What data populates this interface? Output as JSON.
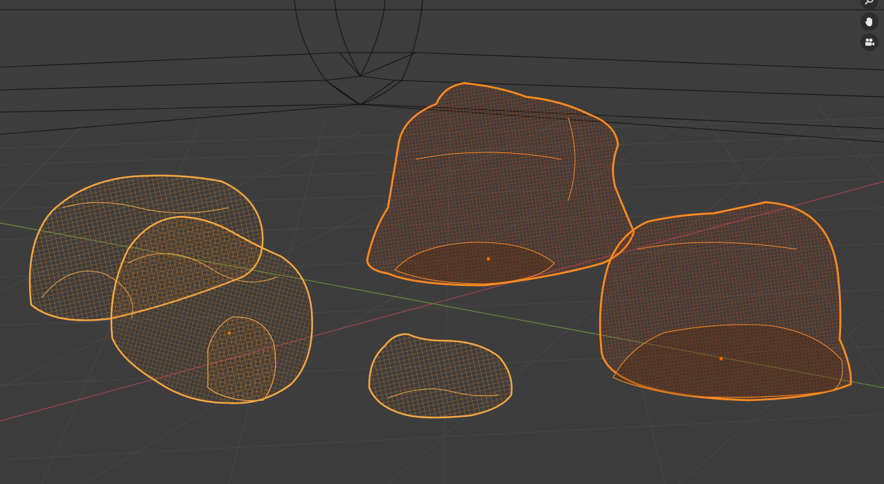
{
  "app": {
    "name": "3D Viewport",
    "shading": "wireframe"
  },
  "colors": {
    "background": "#3d3d3d",
    "grid_line": "#484848",
    "wire_black": "#151515",
    "axis_x": "#a8434f",
    "axis_y": "#6a8f3a",
    "selected_active": "#ff8a1f",
    "selected_other": "#f5a742",
    "object_origin": "#ff6a00"
  },
  "navigation": {
    "zoom_icon": "magnifier-icon",
    "pan_icon": "hand-icon",
    "camera_icon": "camera-icon"
  },
  "scene_objects": [
    {
      "name": "rock-large-left",
      "selection": "selected"
    },
    {
      "name": "rock-front-left",
      "selection": "selected"
    },
    {
      "name": "rock-small-center",
      "selection": "selected"
    },
    {
      "name": "rock-back-center",
      "selection": "active"
    },
    {
      "name": "rock-right",
      "selection": "active"
    }
  ]
}
